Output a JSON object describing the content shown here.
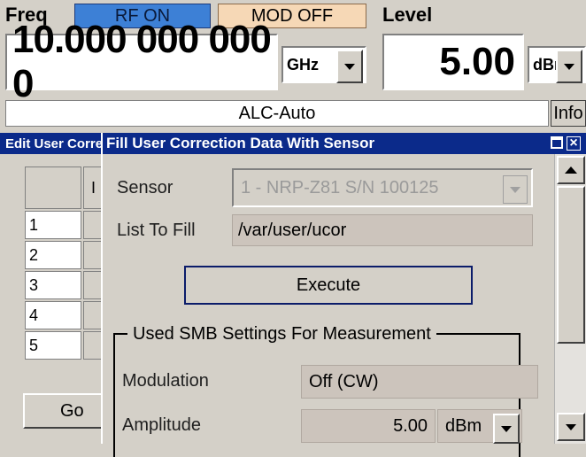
{
  "header": {
    "freq_label": "Freq",
    "rf_status": "RF ON",
    "mod_status": "MOD OFF",
    "level_label": "Level",
    "freq_value": "10.000 000 000 0",
    "freq_unit": "GHz",
    "level_value": "5.00",
    "level_unit": "dBm",
    "alc_status": "ALC-Auto",
    "info_label": "Info"
  },
  "background_dialog": {
    "title": "Edit User Correction Data",
    "column_header_partial": "I",
    "rows": [
      "1",
      "2",
      "3",
      "4",
      "5"
    ],
    "go_label": "Go"
  },
  "dialog": {
    "title": "Fill User Correction Data With Sensor",
    "sensor_label": "Sensor",
    "sensor_value": "1 - NRP-Z81 S/N 100125",
    "list_label": "List To Fill",
    "list_value": "/var/user/ucor",
    "execute_label": "Execute",
    "group_title": "Used SMB Settings For Measurement",
    "modulation_label": "Modulation",
    "modulation_value": "Off (CW)",
    "amplitude_label": "Amplitude",
    "amplitude_value": "5.00",
    "amplitude_unit": "dBm"
  },
  "colors": {
    "rf_on_bg": "#3d80d6",
    "mod_off_bg": "#f6d8b6",
    "titlebar_bg": "#0b2a8a",
    "window_bg": "#d4d0c8"
  }
}
